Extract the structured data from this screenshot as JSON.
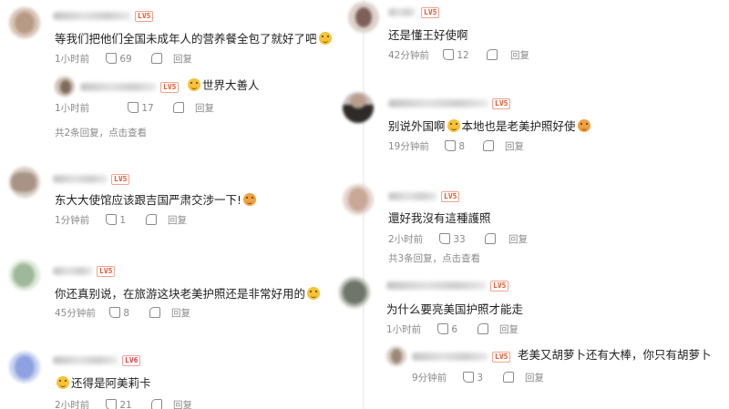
{
  "left": {
    "comments": [
      {
        "level": "LV5",
        "text_before": "等我们把他们全国未成年人的营养餐全包了就好了吧",
        "emoji": "smile-cat-emoji",
        "time": "1小时前",
        "likes": "69",
        "reply_label": "回复"
      },
      {
        "level": "LV5",
        "text_before": "东大大使馆应该跟吉国严肃交涉一下!",
        "emoji": "surprised-emoji",
        "time": "1分钟前",
        "likes": "1",
        "reply_label": "回复"
      },
      {
        "level": "LV5",
        "text_before": "你还真别说，在旅游这块老美护照还是非常好用的",
        "emoji": "smile-cat-emoji",
        "time": "45分钟前",
        "likes": "8",
        "reply_label": "回复"
      },
      {
        "level": "LV6",
        "text_before": "还得是阿美莉卡",
        "emoji": "smile-cat-emoji",
        "time": "2小时前",
        "likes": "21",
        "reply_label": "回复"
      }
    ],
    "reply": {
      "level": "LV5",
      "text": "世界大善人",
      "time": "1小时前",
      "likes": "17",
      "reply_label": "回复"
    },
    "more_replies": "共2条回复，点击查看"
  },
  "right": {
    "comments": [
      {
        "level": "LV5",
        "text_before": "还是懂王好使啊",
        "time": "42分钟前",
        "likes": "12",
        "reply_label": "回复"
      },
      {
        "level": "LV5",
        "text_before": "别说外国啊",
        "text_after": "本地也是老美护照好使",
        "time": "19分钟前",
        "likes": "8",
        "reply_label": "回复"
      },
      {
        "level": "LV5",
        "text_before": "還好我沒有這種護照",
        "time": "2小时前",
        "likes": "33",
        "reply_label": "回复"
      },
      {
        "level": "LV5",
        "text_before": "为什么要亮美国护照才能走",
        "time": "1小时前",
        "likes": "6",
        "reply_label": "回复"
      }
    ],
    "more_replies": "共3条回复，点击查看",
    "reply": {
      "level": "LV5",
      "text": "老美又胡萝卜还有大棒，你只有胡萝卜",
      "time": "9分钟前",
      "likes": "3",
      "reply_label": "回复"
    }
  }
}
